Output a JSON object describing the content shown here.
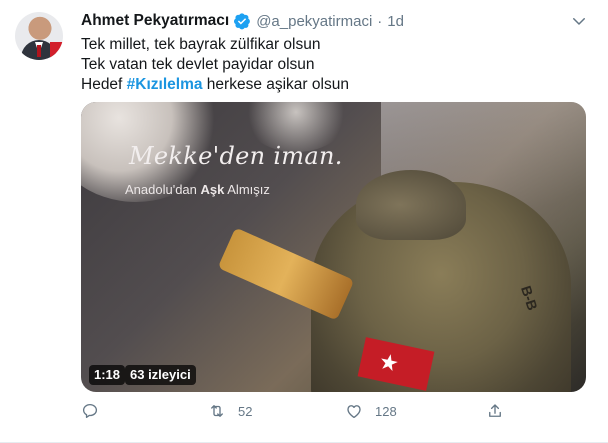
{
  "tweet": {
    "author_name": "Ahmet Pekyatırmacı",
    "handle": "@a_pekyatirmaci",
    "separator": "·",
    "time": "1d",
    "lines": [
      "Tek millet, tek bayrak zülfikar olsun",
      "Tek vatan tek devlet payidar olsun"
    ],
    "line3_prefix": "Hedef ",
    "hashtag": "#Kızılelma",
    "line3_suffix": " herkese aşikar olsun"
  },
  "video": {
    "title_line1": "Mekke'den iman.",
    "title_line2_prefix": "Anadolu'dan ",
    "title_line2_bold": "Aşk",
    "title_line2_suffix": " Almışız",
    "patch_text": "B-B",
    "duration": "1:18",
    "views": "63 izleyici"
  },
  "actions": {
    "retweet_count": "52",
    "like_count": "128"
  },
  "icons": [
    "verified-badge-icon",
    "chevron-down-icon",
    "reply-icon",
    "retweet-icon",
    "like-icon",
    "share-icon"
  ],
  "colors": {
    "accent": "#1b95e0",
    "muted": "#657786",
    "text": "#14171a"
  }
}
